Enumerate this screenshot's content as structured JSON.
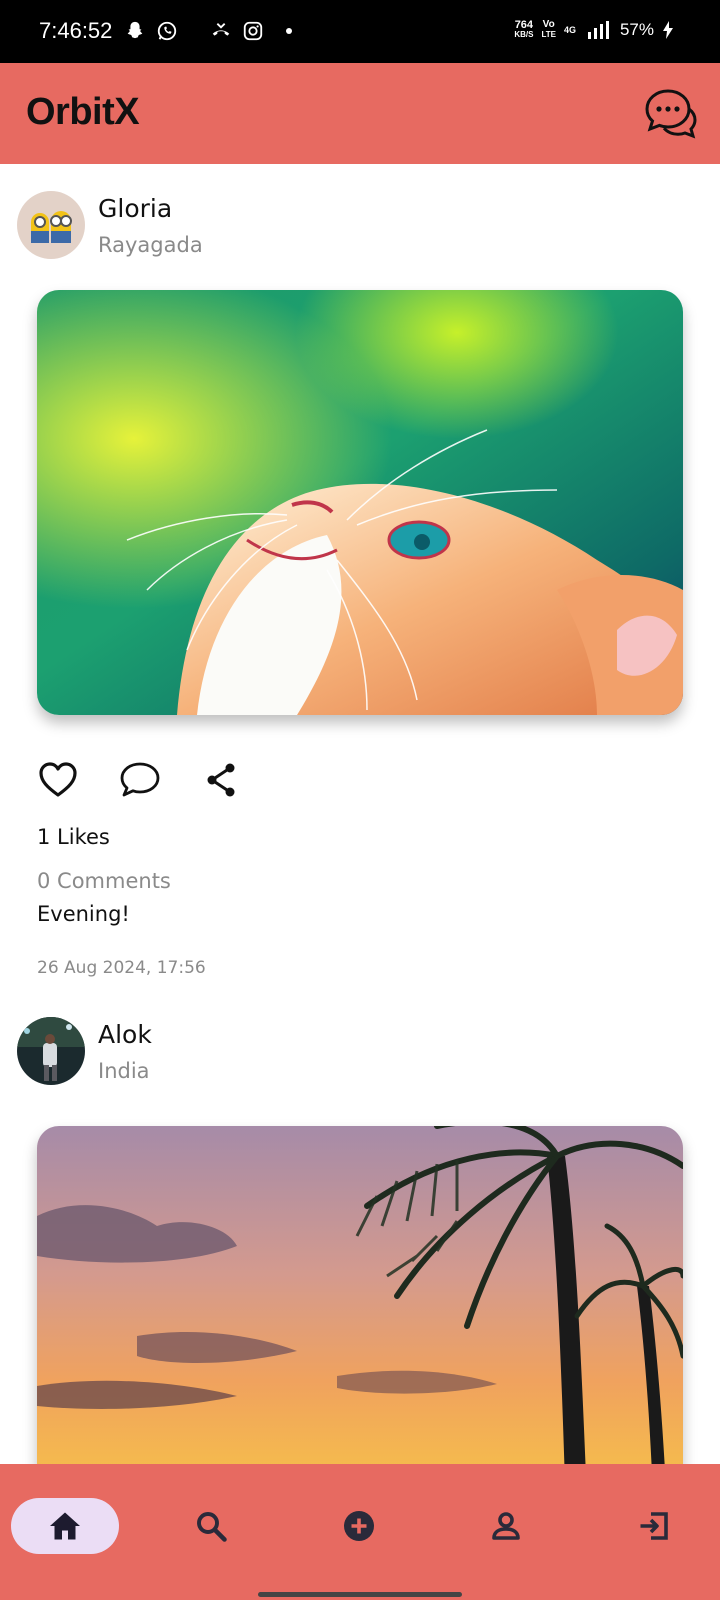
{
  "status_bar": {
    "time": "7:46:52",
    "speed_value": "764",
    "speed_unit": "KB/S",
    "volte_top": "Vo",
    "volte_bottom": "LTE",
    "network": "4G",
    "battery": "57%"
  },
  "app_bar": {
    "title": "OrbitX",
    "chat_icon": "chat-bubbles-icon"
  },
  "posts": [
    {
      "username": "Gloria",
      "location": "Rayagada",
      "image": "kitten-looking-up",
      "likes": "1 Likes",
      "comments": "0 Comments",
      "caption": "Evening!",
      "timestamp": "26 Aug 2024, 17:56"
    },
    {
      "username": "Alok",
      "location": "India",
      "image": "palm-tree-sunset"
    }
  ],
  "bottom_nav": {
    "items": [
      {
        "icon": "home-icon",
        "active": true
      },
      {
        "icon": "search-icon",
        "active": false
      },
      {
        "icon": "add-circle-icon",
        "active": false
      },
      {
        "icon": "person-icon",
        "active": false
      },
      {
        "icon": "logout-icon",
        "active": false
      }
    ],
    "accent": "#E76A61",
    "active_pill": "#EBDDF5"
  }
}
